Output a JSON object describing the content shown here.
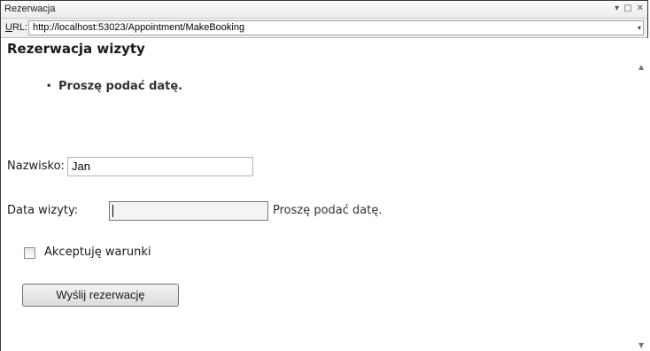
{
  "window": {
    "title": "Rezerwacja",
    "controls": {
      "dropdown": "▾",
      "maximize": "□",
      "close": "✕"
    }
  },
  "address_bar": {
    "label_underlined": "U",
    "label_rest": "RL:",
    "url": "http://localhost:53023/Appointment/MakeBooking",
    "dropdown": "▾"
  },
  "page": {
    "title": "Rezerwacja wizyty",
    "validation_summary": {
      "bullet": "•",
      "items": [
        "Proszę podać datę."
      ]
    },
    "form": {
      "name_label": "Nazwisko:",
      "name_value": "Jan",
      "date_label": "Data wizyty:",
      "date_value": "",
      "date_error": "Proszę podać datę.",
      "terms_label": "Akceptuję warunki",
      "terms_checked": false,
      "submit_label": "Wyślij rezerwację"
    }
  },
  "scrollbar": {
    "up": "▲",
    "down": "▼"
  }
}
